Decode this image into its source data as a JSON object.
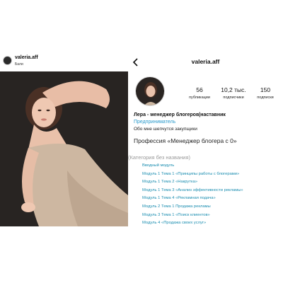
{
  "post": {
    "username": "valeria.aff",
    "location": "Бали"
  },
  "profile": {
    "username": "valeria.aff",
    "stats": [
      {
        "value": "56",
        "label": "публикации"
      },
      {
        "value": "10,2 тыс.",
        "label": "подписчики"
      },
      {
        "value": "150",
        "label": "подписки"
      }
    ],
    "bio": {
      "name": "Лера - менеджер блогеров|наставник",
      "category": "Предприниматель",
      "text": "Обо мне шепчутся закупщики",
      "profession": "Профессия «Менеджер блогера с 0»"
    }
  },
  "course": {
    "category_title": "(Категория без названия)",
    "items": [
      "Вводный модуль",
      "Модуль 1 Тема 1 «Принципы работы с блогерами»",
      "Модуль 1 Тема 2 «Накрутка»",
      "Модуль 1 Тема 3 «Анализ эффективности рекламы»",
      "Модуль 1 Тема 4 «Рекламная подача»",
      "Модуль 2 Тема 1 Продажа рекламы",
      "Модуль 3 Тема 1 «Поиск клиентов»",
      "Модуль 4 «Продажа своих услуг»"
    ]
  },
  "icons": {
    "back": "chevron-left-icon"
  },
  "colors": {
    "link_blue": "#2a9acb",
    "course_blue": "#1a8db0",
    "muted_gray": "#9a9a9a"
  }
}
